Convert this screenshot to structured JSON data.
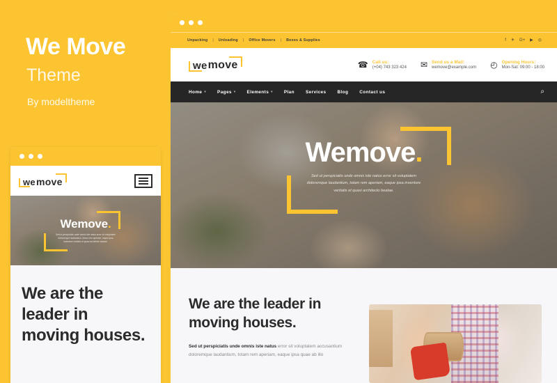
{
  "promo": {
    "title": "We Move",
    "subtitle": "Theme",
    "author": "By modeltheme"
  },
  "colors": {
    "brand_yellow": "#FBC430",
    "dark_nav": "#262626",
    "section_bg": "#F7F7F9",
    "text_dark": "#2B2B2B"
  },
  "mobile": {
    "window_dots": [
      "dot-1",
      "dot-2",
      "dot-3"
    ],
    "logo": {
      "part1": "we",
      "part2": "move"
    },
    "menu_icon": "hamburger-icon",
    "hero": {
      "title": "Wemove",
      "accent": ".",
      "text": "Sed ut perspiciatis unde omnis iste natus error sit voluptatem doloremque laudantium, totam rem aperiam, eaque ipsa inventore veritatis et quasi architecto beatae."
    },
    "body_heading": "We are the leader in moving houses."
  },
  "browser": {
    "window_dots": [
      "dot-1",
      "dot-2",
      "dot-3"
    ],
    "topbar": {
      "links": [
        "Unpacking",
        "Unloading",
        "Office Movers",
        "Boxes & Supplies"
      ],
      "separator": "|",
      "socials": [
        {
          "name": "facebook-icon",
          "glyph": "f"
        },
        {
          "name": "twitter-icon",
          "glyph": "✈"
        },
        {
          "name": "google-plus-icon",
          "glyph": "G+"
        },
        {
          "name": "youtube-icon",
          "glyph": "▶"
        },
        {
          "name": "instagram-icon",
          "glyph": "◎"
        }
      ]
    },
    "header": {
      "logo": {
        "part1": "we",
        "part2": "move"
      },
      "contacts": [
        {
          "icon": "phone-icon",
          "glyph": "☎",
          "title": "Call us:",
          "value": "(+04) 743 323 424"
        },
        {
          "icon": "mail-icon",
          "glyph": "✉",
          "title": "Send us a Mail:",
          "value": "wemove@example.com"
        },
        {
          "icon": "clock-icon",
          "glyph": "◴",
          "title": "Opening Hours:",
          "value": "Mon-Sat: 09:00 - 18:00"
        }
      ]
    },
    "nav": {
      "items": [
        {
          "label": "Home",
          "caret": "▾"
        },
        {
          "label": "Pages",
          "caret": "▾"
        },
        {
          "label": "Elements",
          "caret": "▾"
        },
        {
          "label": "Plan",
          "caret": ""
        },
        {
          "label": "Services",
          "caret": ""
        },
        {
          "label": "Blog",
          "caret": ""
        },
        {
          "label": "Contact us",
          "caret": ""
        }
      ],
      "search_icon": "search-icon",
      "search_glyph": "⌕"
    },
    "hero": {
      "title": "Wemove",
      "accent": ".",
      "text": "Sed ut perspiciatis unde omnis iste natus error sit voluptatem doloremque laudantium, totam rem aperiam, eaque ipsa inventore veritatis et quasi architecto beatae."
    },
    "section": {
      "heading": "We are the leader in moving houses.",
      "paragraph_bold": "Sed ut perspiciatis unde omnis iste natus",
      "paragraph_rest": " error sit voluptatem accusantium doloremque laudantium, totam rem aperiam, eaque ipsa quae ab illo",
      "image_alt": "tape-dispenser-photo"
    }
  }
}
